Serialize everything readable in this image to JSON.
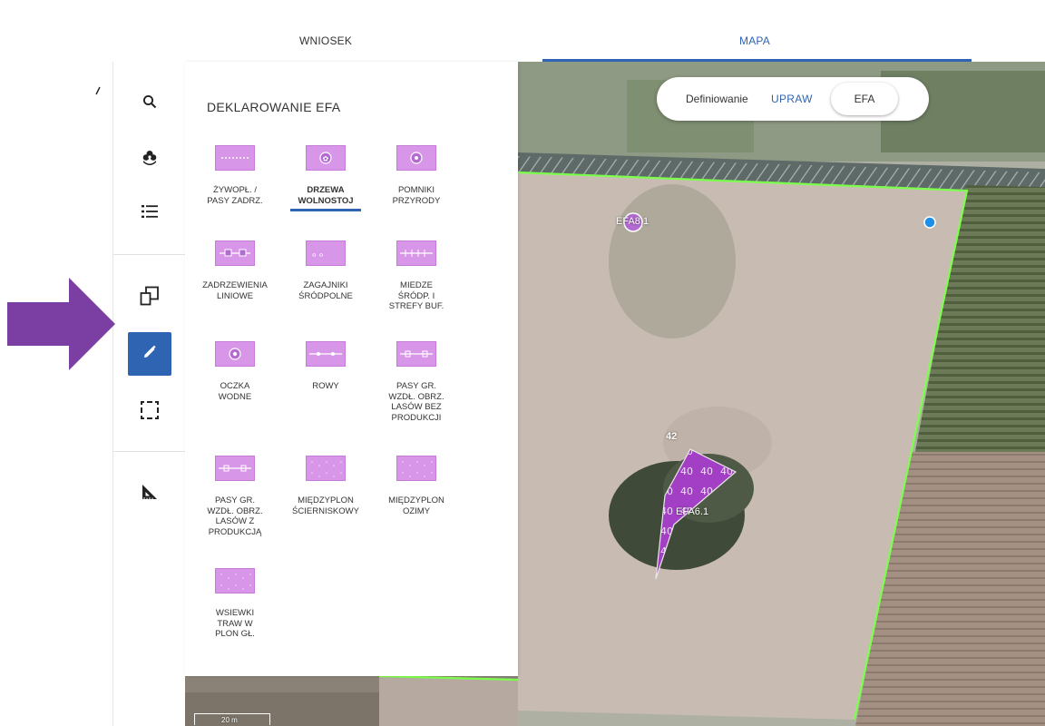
{
  "tabs": {
    "wniosek": "WNIOSEK",
    "mapa": "MAPA"
  },
  "panel": {
    "title": "DEKLAROWANIE EFA",
    "items": [
      {
        "label_lines": [
          "ŻYWOPŁ. /",
          "PASY ZADRZ."
        ]
      },
      {
        "label_lines": [
          "DRZEWA",
          "WOLNOSTOJ"
        ]
      },
      {
        "label_lines": [
          "POMNIKI",
          "PRZYRODY"
        ]
      },
      {
        "label_lines": [
          "ZADRZEWIENIA",
          "LINIOWE"
        ]
      },
      {
        "label_lines": [
          "ZAGAJNIKI",
          "ŚRÓDPOLNE"
        ]
      },
      {
        "label_lines": [
          "MIEDZE",
          "ŚRÓDP. I",
          "STREFY BUF."
        ]
      },
      {
        "label_lines": [
          "OCZKA",
          "WODNE"
        ]
      },
      {
        "label_lines": [
          "ROWY"
        ]
      },
      {
        "label_lines": [
          "PASY GR.",
          "WZDŁ. OBRZ.",
          "LASÓW BEZ",
          "PRODUKCJI"
        ]
      },
      {
        "label_lines": [
          "PASY GR.",
          "WZDŁ. OBRZ.",
          "LASÓW Z",
          "PRODUKCJĄ"
        ]
      },
      {
        "label_lines": [
          "MIĘDZYPLON",
          "ŚCIERNISKOWY"
        ]
      },
      {
        "label_lines": [
          "MIĘDZYPLON",
          "OZIMY"
        ]
      },
      {
        "label_lines": [
          "WSIEWKI",
          "TRAW W",
          "PLON GŁ."
        ]
      }
    ]
  },
  "toggle": {
    "label": "Definiowanie",
    "upraw": "UPRAW",
    "efa": "EFA"
  },
  "map": {
    "marker1": "EFA8.1",
    "marker2": "EFA6.1",
    "parcel_num": "42",
    "scale": "20 m"
  },
  "icons": [
    "search-icon",
    "eco-icon",
    "list-icon",
    "copy-icon",
    "edit-icon",
    "select-icon",
    "ruler-icon",
    "arrow-right-icon",
    "slash-mark"
  ],
  "colors": {
    "accent": "#2f64b3",
    "efa_fill": "#d896e8",
    "arrow": "#7b3fa3",
    "parcel_outline": "#7cff4c"
  }
}
